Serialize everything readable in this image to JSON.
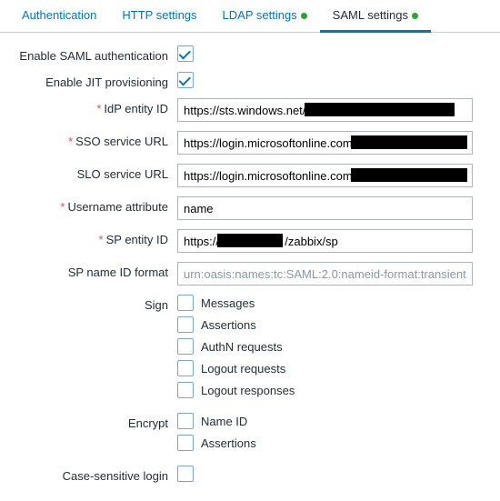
{
  "tabs": {
    "auth": "Authentication",
    "http": "HTTP settings",
    "ldap": "LDAP settings",
    "saml": "SAML settings"
  },
  "labels": {
    "enable_saml": "Enable SAML authentication",
    "enable_jit": "Enable JIT provisioning",
    "idp_entity": "IdP entity ID",
    "sso_url": "SSO service URL",
    "slo_url": "SLO service URL",
    "username_attr": "Username attribute",
    "sp_entity": "SP entity ID",
    "sp_name_id": "SP name ID format",
    "sign": "Sign",
    "encrypt": "Encrypt",
    "case_sensitive": "Case-sensitive login"
  },
  "sign_opts": {
    "messages": "Messages",
    "assertions": "Assertions",
    "authn": "AuthN requests",
    "logout_req": "Logout requests",
    "logout_resp": "Logout responses"
  },
  "encrypt_opts": {
    "nameid": "Name ID",
    "assertions": "Assertions"
  },
  "values": {
    "idp_entity_prefix": "https://sts.windows.net/",
    "sso_url_prefix": "https://login.microsoftonline.com/",
    "slo_url_prefix": "https://login.microsoftonline.com/",
    "username_attr": "name",
    "sp_entity_prefix": "https://",
    "sp_entity_suffix": "/zabbix/sp",
    "sp_name_id_placeholder": "urn:oasis:names:tc:SAML:2.0:nameid-format:transient"
  },
  "checked": {
    "enable_saml": true,
    "enable_jit": true
  }
}
